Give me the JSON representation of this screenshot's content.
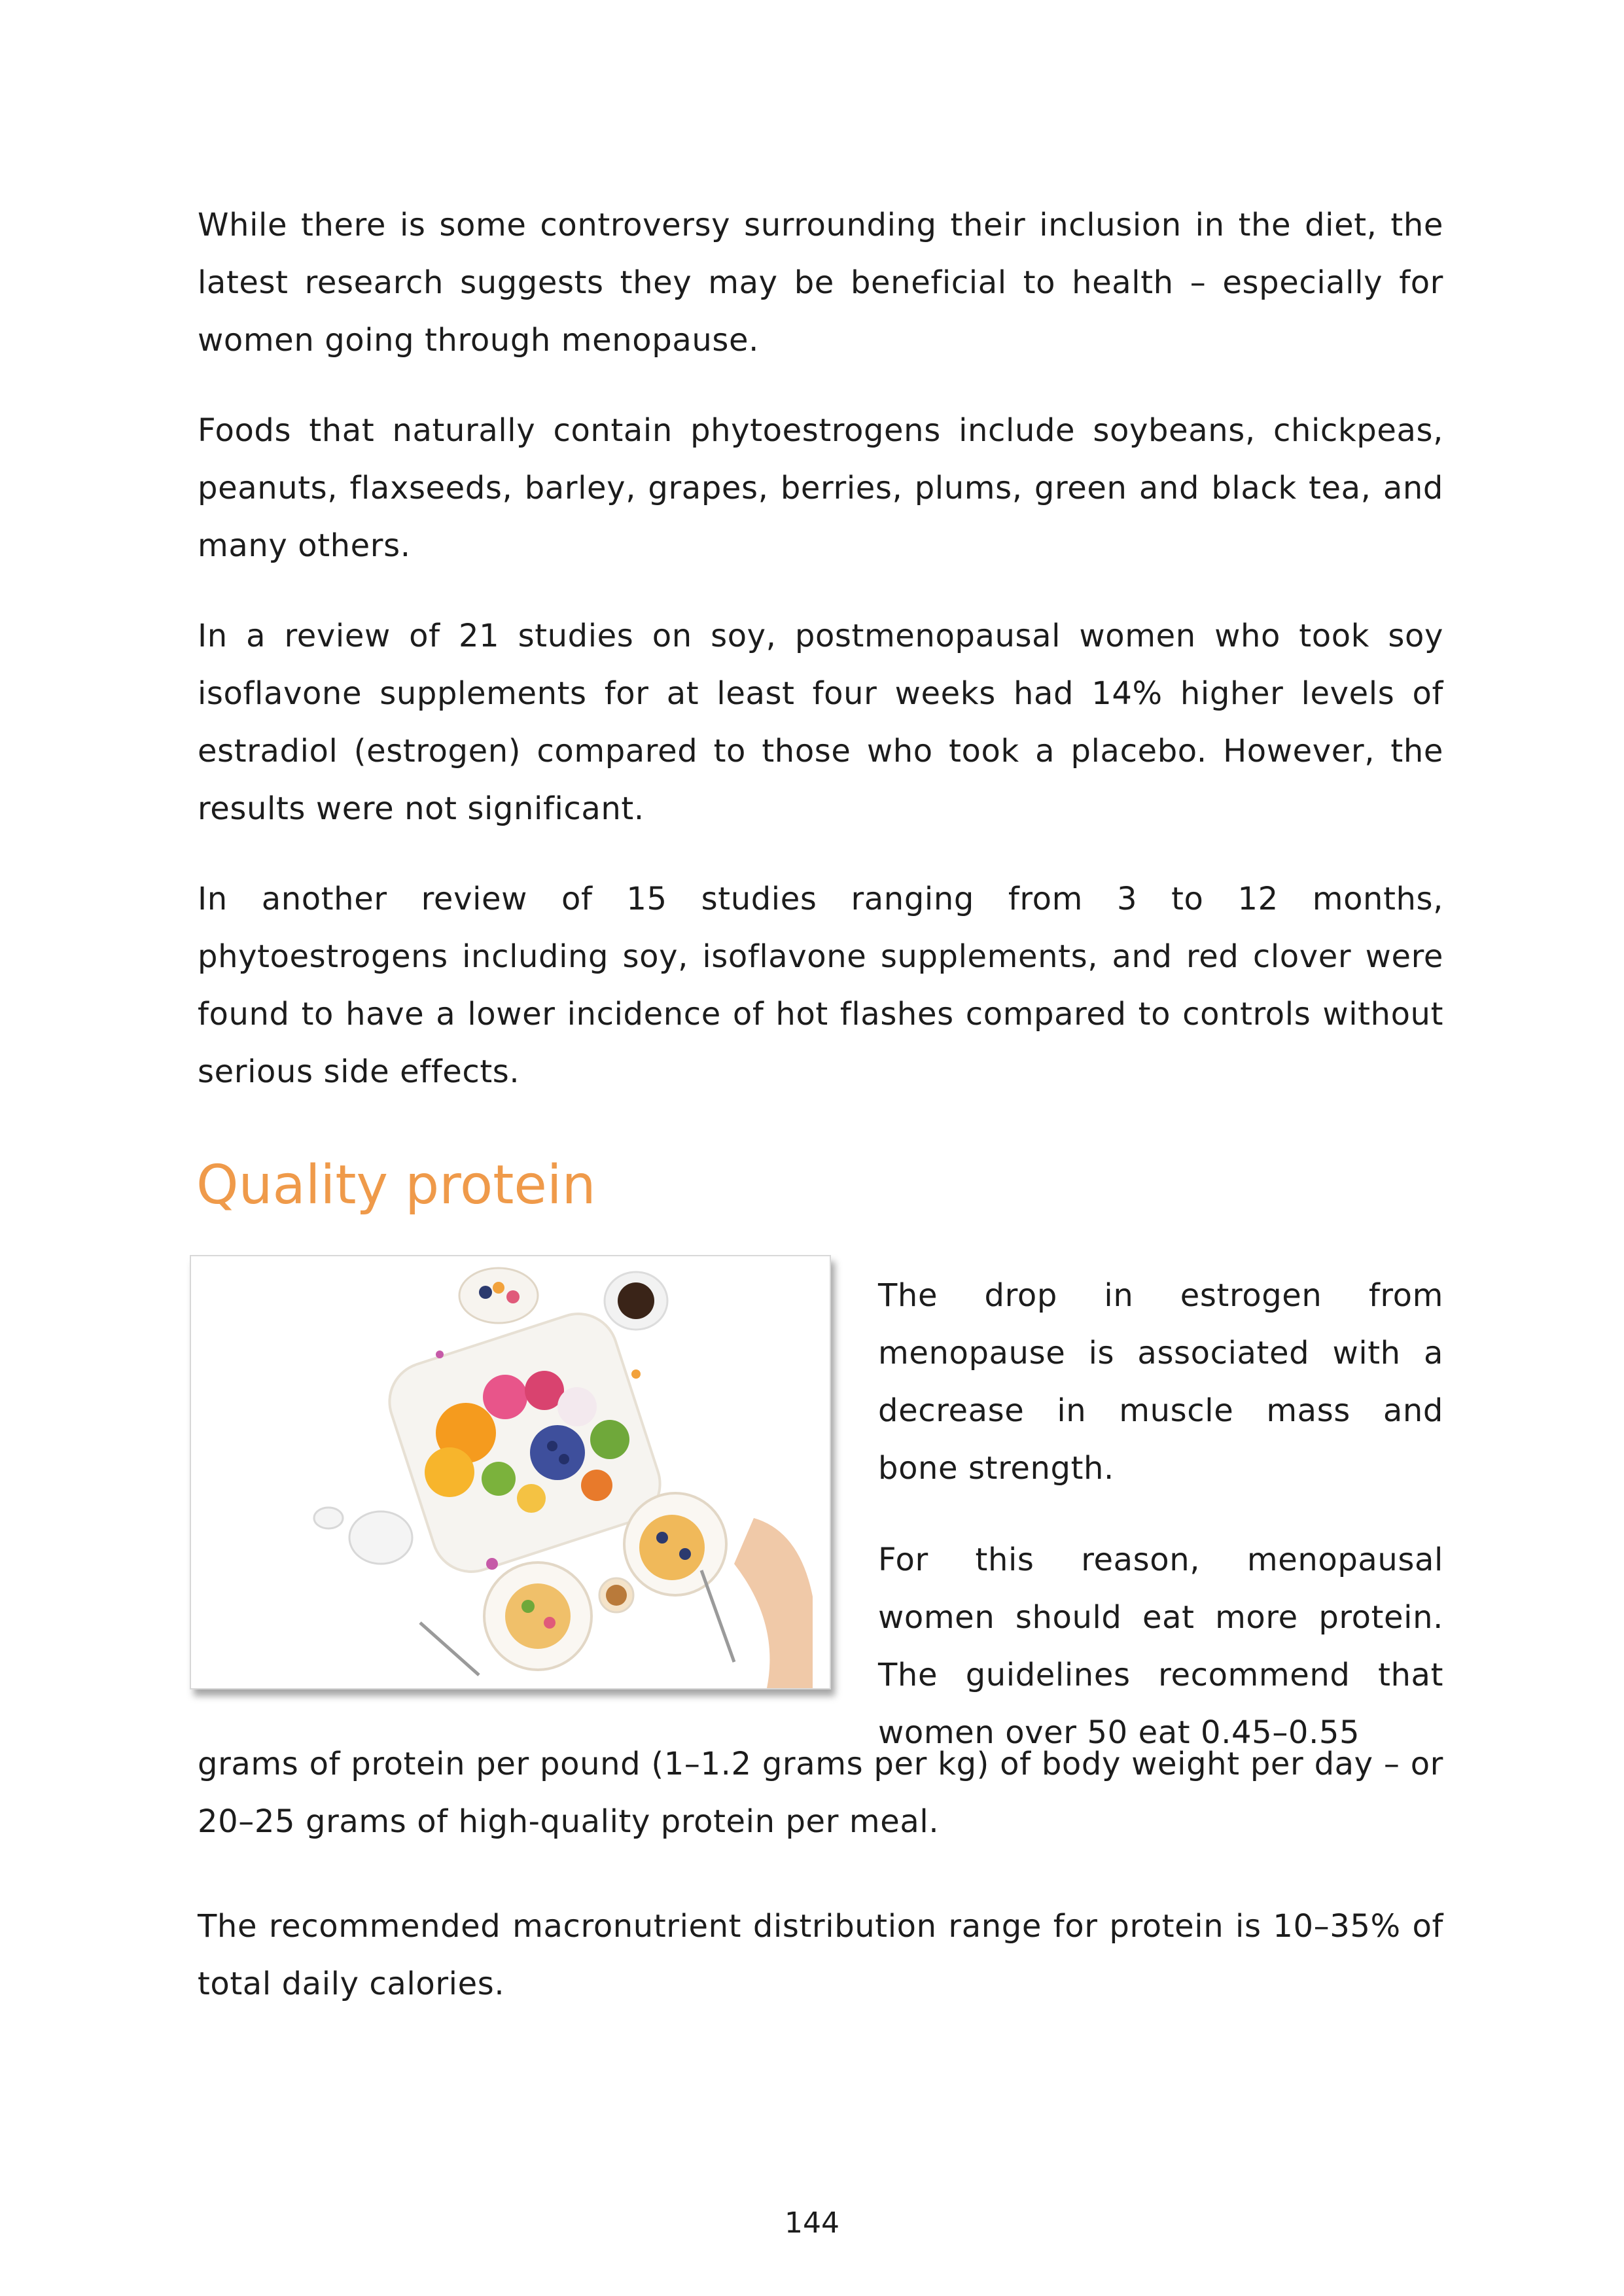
{
  "paragraphs": {
    "p1": "While there is some controversy surrounding their inclusion in the diet, the latest research suggests they may be beneficial to health – especially for women going through menopause.",
    "p2": "Foods that naturally contain phytoestrogens include soybeans, chickpeas, peanuts, flaxseeds, barley, grapes, berries, plums, green and black tea, and many others.",
    "p3": "In a review of 21 studies on soy, postmenopausal women who took soy isoflavone supplements for at least four weeks had 14% higher levels of estradiol (estrogen) compared to those who took a placebo. However, the results were not significant.",
    "p4": "In another review of 15 studies ranging from 3 to 12 months, phytoestrogens including soy, isoflavone supplements, and red clover were found to have a lower incidence of hot flashes compared to controls without serious side effects."
  },
  "section": {
    "heading": "Quality protein",
    "side_p1": "The drop in estrogen from menopause is associated with a decrease in muscle mass and bone strength.",
    "side_p2": "For this reason, menopausal women should eat more protein. The guidelines recommend that women over 50 eat 0.45–0.55",
    "continuation": "grams of protein per pound (1–1.2 grams per kg) of body weight per day – or 20–25 grams of high-quality protein per meal.",
    "last_paragraph": "The recommended macronutrient distribution range for protein is 10–35% of total daily calories."
  },
  "photo": {
    "subject": "food-platter-photo"
  },
  "footer": {
    "page_number": "144"
  },
  "colors": {
    "heading": "#ef9a4a",
    "text": "#1c1c1c"
  }
}
